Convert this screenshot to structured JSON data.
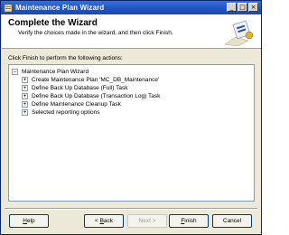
{
  "window": {
    "title": "Maintenance Plan Wizard"
  },
  "title_buttons": {
    "minimize": "_",
    "maximize": "□",
    "close": "×"
  },
  "header": {
    "title": "Complete the Wizard",
    "subtitle": "Verify the choices made in the wizard, and then click Finish."
  },
  "prompt": "Click Finish to perform the following actions:",
  "tree": {
    "root": "Maintenance Plan Wizard",
    "root_expander": "−",
    "child_expander": "+",
    "children": [
      "Create Maintenance Plan 'MC_DB_Maintenance'",
      "Define Back Up Database (Full) Task",
      "Define Back Up Database (Transaction Log) Task",
      "Define Maintenance Cleanup Task",
      "Selected reporting options"
    ]
  },
  "buttons": {
    "help": {
      "mnemonic": "H",
      "rest": "elp"
    },
    "back": {
      "prefix": "< ",
      "mnemonic": "B",
      "rest": "ack"
    },
    "next": {
      "label": "Next >"
    },
    "finish": {
      "mnemonic": "F",
      "rest": "inish"
    },
    "cancel": {
      "label": "Cancel"
    }
  },
  "colors": {
    "titlebar": "#2458c8",
    "dialog_bg": "#ece9d8",
    "panel_border": "#7f9db9"
  }
}
